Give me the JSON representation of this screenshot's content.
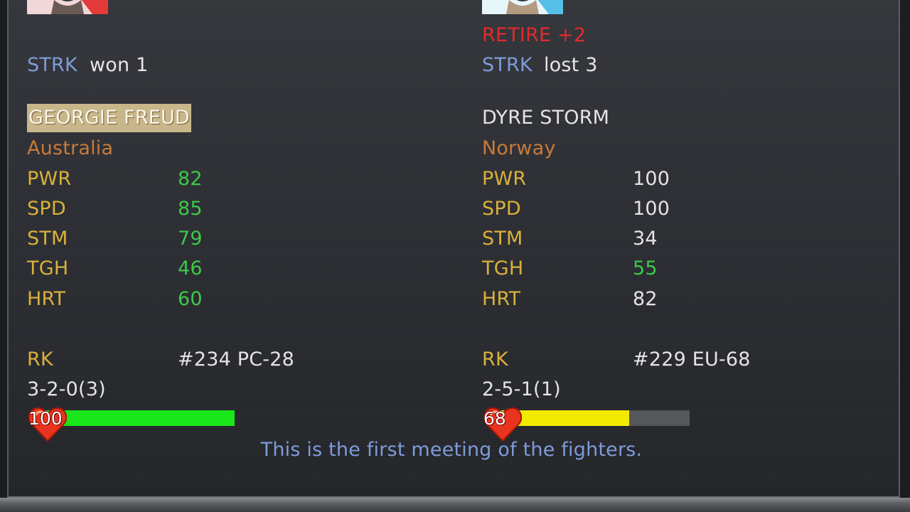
{
  "colors": {
    "label_blue": "#7f9bd9",
    "stat_gold": "#d9b13b",
    "stat_green": "#3dc94a",
    "country_orange": "#c87a3a",
    "retire_red": "#e12b2b",
    "hp_green": "#19e619",
    "hp_yellow": "#f2ea00"
  },
  "left": {
    "streak_label": "STRK",
    "streak_value": "won 1",
    "name": "GEORGIE FREUD",
    "country": "Australia",
    "stats": [
      {
        "label": "PWR",
        "value": "82"
      },
      {
        "label": "SPD",
        "value": "85"
      },
      {
        "label": "STM",
        "value": "79"
      },
      {
        "label": "TGH",
        "value": "46"
      },
      {
        "label": "HRT",
        "value": "60"
      }
    ],
    "rank_label": "RK",
    "rank_value": "#234 PC-28",
    "record": "3-2-0(3)",
    "health": "100",
    "health_fraction": 1.0
  },
  "right": {
    "retire": "RETIRE +2",
    "streak_label": "STRK",
    "streak_value": "lost 3",
    "name": "DYRE STORM",
    "country": "Norway",
    "stats": [
      {
        "label": "PWR",
        "value": "100"
      },
      {
        "label": "SPD",
        "value": "100"
      },
      {
        "label": "STM",
        "value": "34"
      },
      {
        "label": "TGH",
        "value": "55"
      },
      {
        "label": "HRT",
        "value": "82"
      }
    ],
    "rank_label": "RK",
    "rank_value": "#229 EU-68",
    "record": "2-5-1(1)",
    "health": "68",
    "health_fraction": 0.68
  },
  "message": "This is the first meeting of the fighters."
}
